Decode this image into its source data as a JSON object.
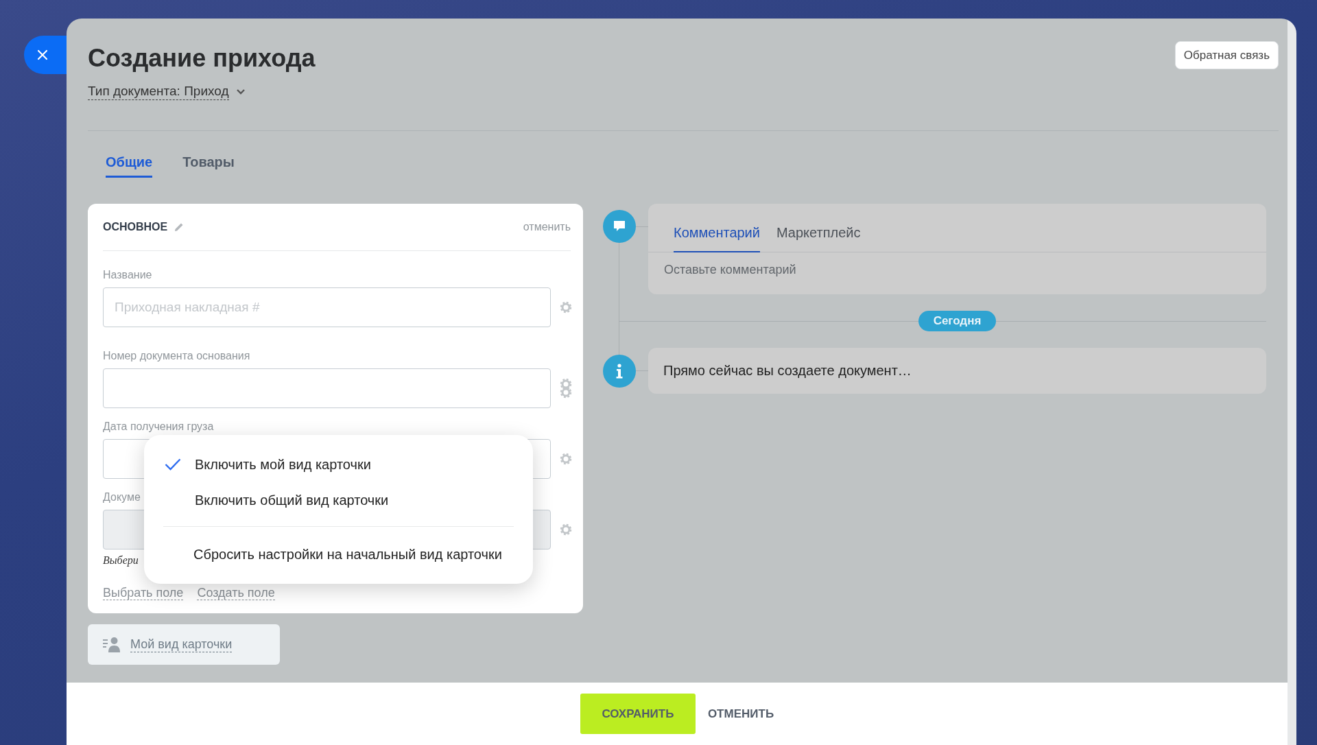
{
  "header": {
    "title": "Создание прихода",
    "document_type": "Тип документа: Приход",
    "feedback_button": "Обратная связь"
  },
  "tabs": [
    {
      "label": "Общие",
      "selected": true
    },
    {
      "label": "Товары",
      "selected": false
    }
  ],
  "main_section": {
    "title": "ОСНОВНОЕ",
    "cancel": "отменить",
    "fields": [
      {
        "kind": "input",
        "label": "Название",
        "placeholder": "Приходная накладная #",
        "stacked_gears": false
      },
      {
        "kind": "input",
        "label": "Номер документа основания",
        "stacked_gears": true
      },
      {
        "kind": "input",
        "label": "Дата получения груза",
        "stacked_gears": false
      },
      {
        "kind": "file",
        "label": "Докуме",
        "hint": "Выбери",
        "stacked_gears": false
      }
    ],
    "links": [
      "Выбрать поле",
      "Создать поле"
    ]
  },
  "card_view_button": "Мой вид карточки",
  "menu": {
    "items": [
      {
        "label": "Включить мой вид карточки",
        "checked": true
      },
      {
        "label": "Включить общий вид карточки",
        "checked": false
      }
    ],
    "reset_item": "Сбросить настройки на начальный вид карточки"
  },
  "timeline": {
    "composer": {
      "tabs": [
        {
          "label": "Комментарий",
          "selected": true
        },
        {
          "label": "Маркетплейс",
          "selected": false
        }
      ],
      "placeholder": "Оставьте комментарий"
    },
    "date_badge": "Сегодня",
    "entries": [
      {
        "text": "Прямо сейчас вы создаете документ…"
      }
    ]
  },
  "footer": {
    "save": "СОХРАНИТЬ",
    "cancel": "ОТМЕНИТЬ"
  }
}
